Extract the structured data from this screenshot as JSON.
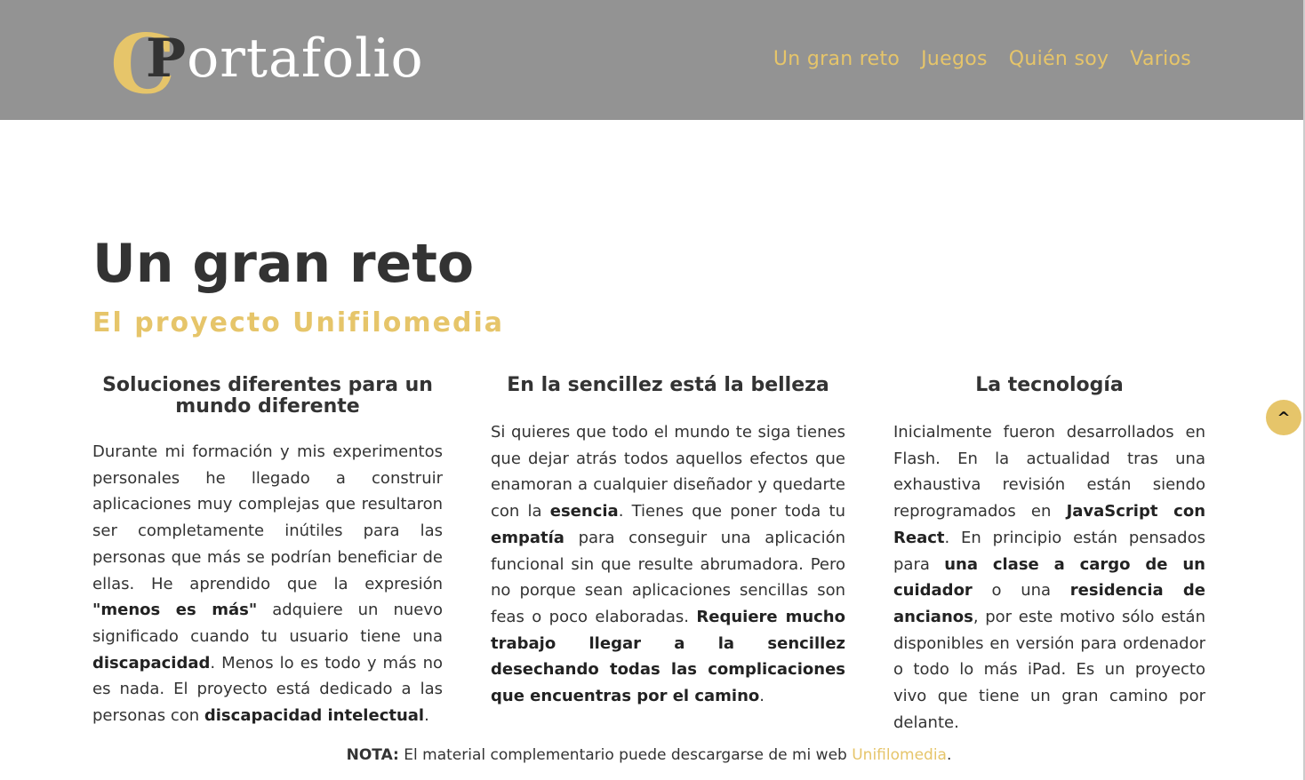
{
  "header": {
    "logo_letter": "C",
    "logo_p": "P",
    "logo_rest": "ortafolio",
    "nav": [
      "Un gran reto",
      "Juegos",
      "Quién soy",
      "Varios"
    ]
  },
  "main": {
    "title": "Un gran reto",
    "subtitle": "El proyecto Unifilomedia",
    "columns": [
      {
        "heading": "Soluciones diferentes para un mundo diferente",
        "segments": [
          {
            "t": "Durante mi formación y mis experimentos personales he llegado a construir aplicaciones muy complejas que resultaron ser completamente inútiles para las personas que más se podrían beneficiar de ellas. He aprendido que la expresión ",
            "b": false
          },
          {
            "t": "\"menos es más\"",
            "b": true
          },
          {
            "t": " adquiere un nuevo significado cuando tu usuario tiene una ",
            "b": false
          },
          {
            "t": "discapacidad",
            "b": true
          },
          {
            "t": ". Menos lo es todo y más no es nada. El proyecto está dedicado a las personas con ",
            "b": false
          },
          {
            "t": "discapacidad intelectual",
            "b": true
          },
          {
            "t": ".",
            "b": false
          }
        ]
      },
      {
        "heading": "En la sencillez está la belleza",
        "segments": [
          {
            "t": "Si quieres que todo el mundo te siga tienes que dejar atrás todos aquellos efectos que enamoran a cualquier diseñador y quedarte con la ",
            "b": false
          },
          {
            "t": "esencia",
            "b": true
          },
          {
            "t": ". Tienes que poner toda tu ",
            "b": false
          },
          {
            "t": "empatía",
            "b": true
          },
          {
            "t": " para conseguir una aplicación funcional sin que resulte abrumadora. Pero no porque sean aplicaciones sencillas son feas o poco elaboradas. ",
            "b": false
          },
          {
            "t": "Requiere mucho trabajo llegar a la sencillez desechando todas las complicaciones que encuentras por el camino",
            "b": true
          },
          {
            "t": ".",
            "b": false
          }
        ]
      },
      {
        "heading": "La tecnología",
        "segments": [
          {
            "t": "Inicialmente fueron desarrollados en Flash. En la actualidad tras una exhaustiva revisión están siendo reprogramados en ",
            "b": false
          },
          {
            "t": "JavaScript con React",
            "b": true
          },
          {
            "t": ". En principio están pensados para ",
            "b": false
          },
          {
            "t": "una clase a cargo de un cuidador",
            "b": true
          },
          {
            "t": " o una ",
            "b": false
          },
          {
            "t": "residencia de ancianos",
            "b": true
          },
          {
            "t": ", por este motivo sólo están disponibles en versión para ordenador o todo lo más iPad. Es un proyecto vivo que tiene un gran camino por delante.",
            "b": false
          }
        ]
      }
    ]
  },
  "note": {
    "label": "NOTA:",
    "text": " El material complementario puede descargarse de mi web ",
    "link": "Unifilomedia",
    "end": "."
  },
  "scroll_top": {
    "label": "^"
  },
  "colors": {
    "accent": "#e6c56a",
    "header_bg": "#939393",
    "text": "#333333"
  }
}
